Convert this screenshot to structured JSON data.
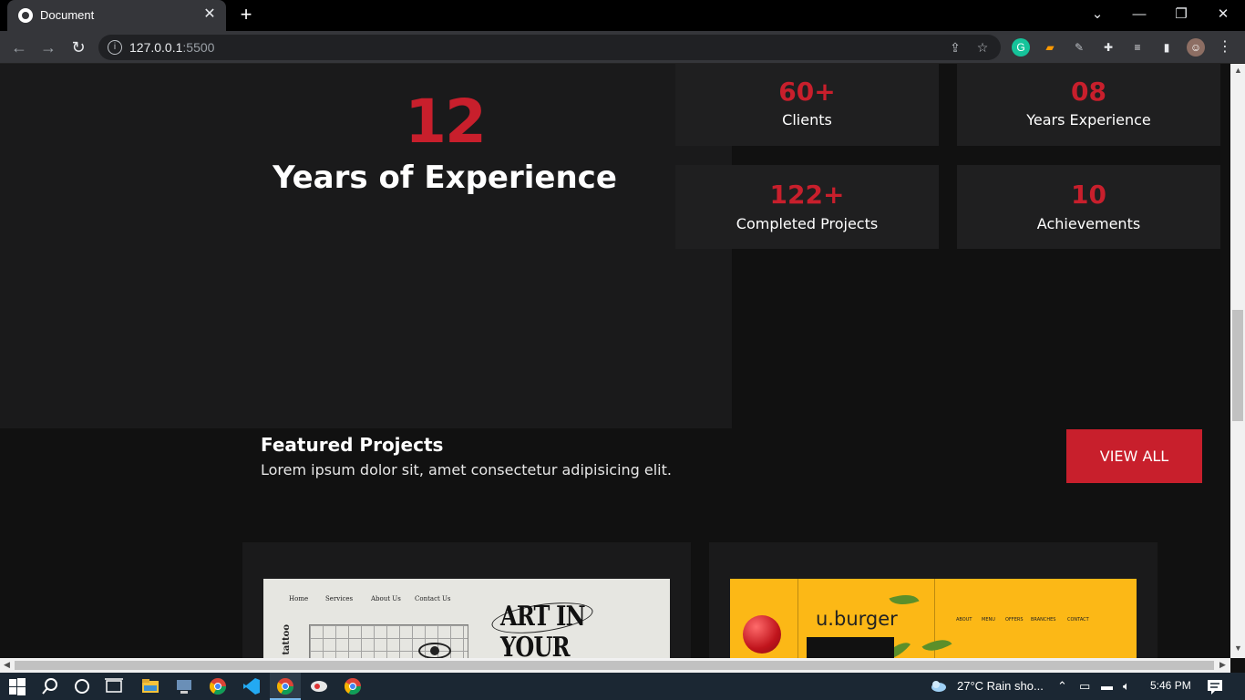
{
  "browser": {
    "tab_title": "Document",
    "url_host": "127.0.0.1",
    "url_port": ":5500"
  },
  "experience": {
    "number": "12",
    "title": "Years of Experience"
  },
  "stats": [
    {
      "value": "60+",
      "label": "Clients"
    },
    {
      "value": "08",
      "label": "Years Experience"
    },
    {
      "value": "122+",
      "label": "Completed Projects"
    },
    {
      "value": "10",
      "label": "Achievements"
    }
  ],
  "featured": {
    "title": "Featured Projects",
    "description": "Lorem ipsum dolor sit, amet consectetur adipisicing elit.",
    "view_all_label": "VIEW ALL"
  },
  "projects": {
    "tattoo": {
      "nav": [
        "Home",
        "Services",
        "About Us",
        "Contact Us"
      ],
      "side_text": "ur tattoo",
      "headline_1": "ART IN",
      "headline_2": "YOUR SKIN"
    },
    "burger": {
      "logo": "u.burger",
      "nav": [
        "ABOUT",
        "MENU",
        "OFFERS",
        "BRANCHES",
        "CONTACT"
      ]
    }
  },
  "taskbar": {
    "weather": "27°C  Rain sho...",
    "time": "5:46 PM"
  },
  "colors": {
    "accent": "#c81f2c",
    "background": "#111111",
    "panel": "#1a1a1b",
    "card": "#1f1f20"
  }
}
